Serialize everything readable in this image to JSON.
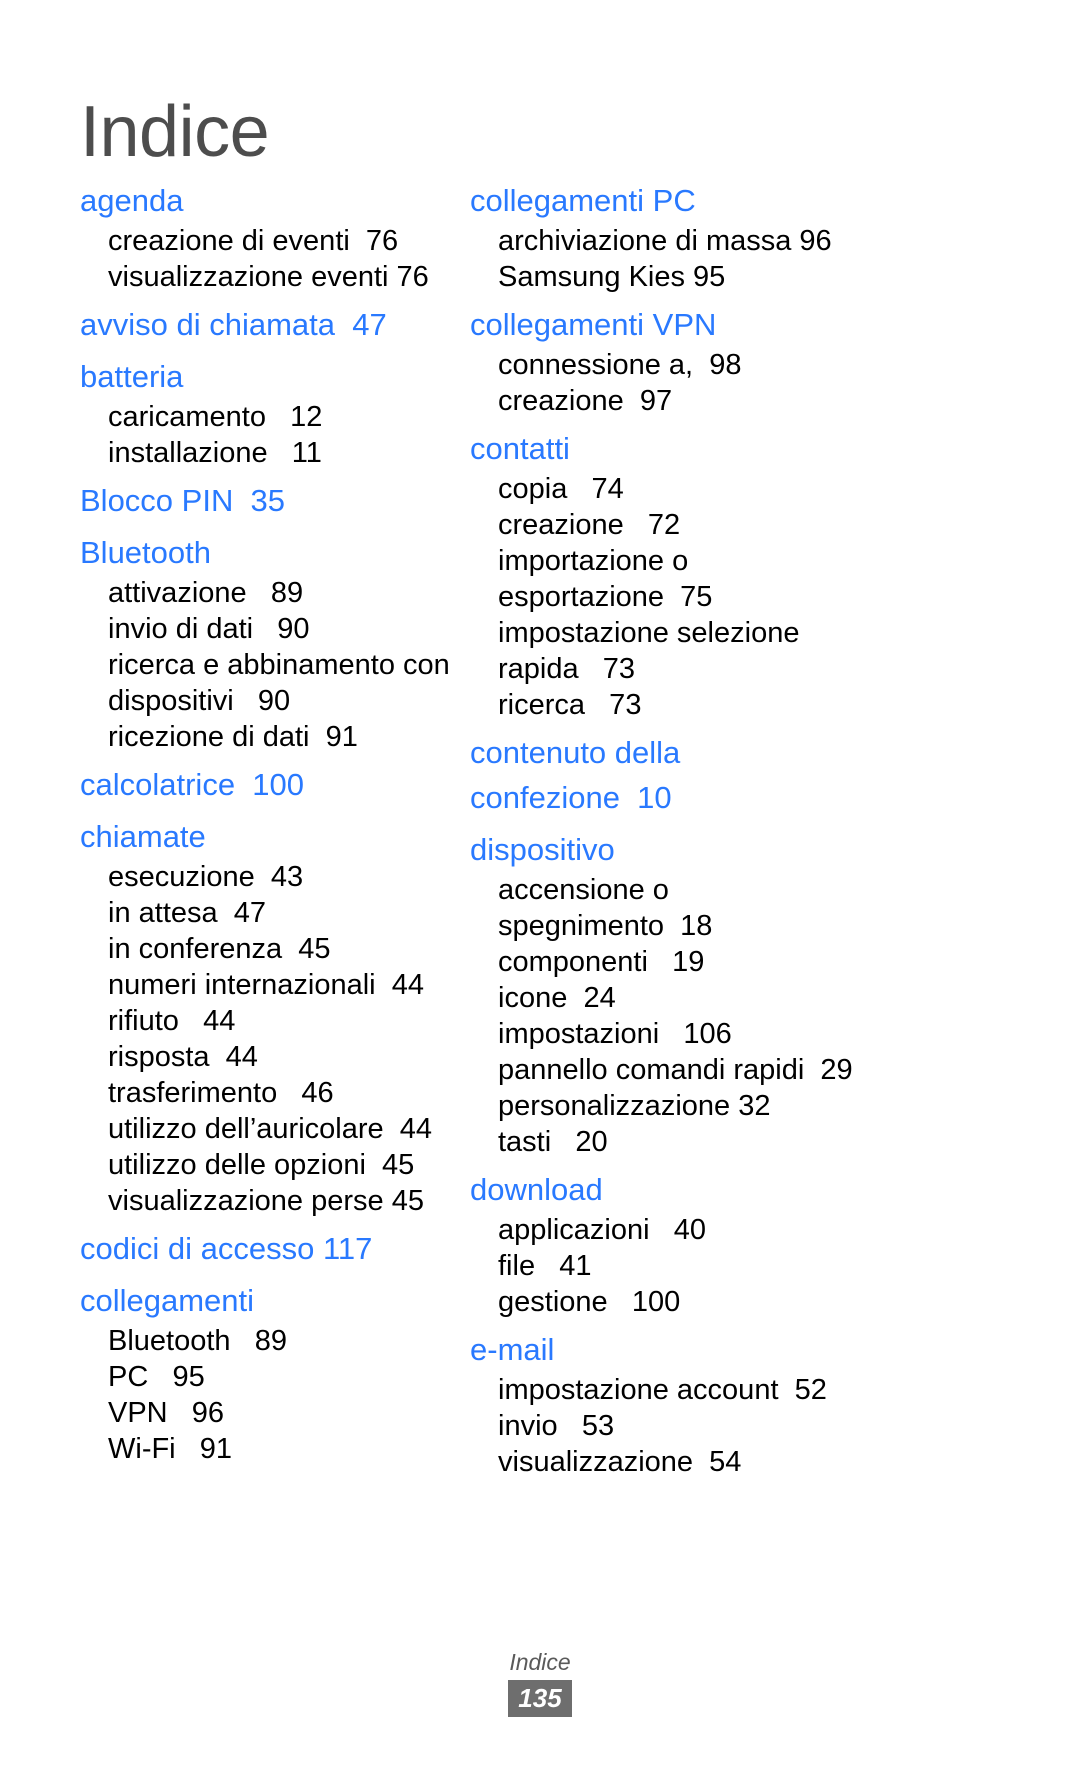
{
  "document": {
    "title": "Indice",
    "accent_color": "#2979ff",
    "title_color": "#4d4d4d",
    "body_color": "#000000"
  },
  "columns": {
    "left": [
      {
        "heading": "agenda",
        "lines": [
          "creazione di eventi  76",
          "visualizzazione eventi 76"
        ]
      },
      {
        "heading": "avviso di chiamata  47",
        "lines": []
      },
      {
        "heading": "batteria",
        "lines": [
          "caricamento   12",
          "installazione   11"
        ]
      },
      {
        "heading": "Blocco PIN  35",
        "lines": []
      },
      {
        "heading": "Bluetooth",
        "lines": [
          "attivazione   89",
          "invio di dati   90",
          "ricerca e abbinamento con",
          "dispositivi   90",
          "ricezione di dati  91"
        ]
      },
      {
        "heading": "calcolatrice  100",
        "lines": []
      },
      {
        "heading": "chiamate",
        "lines": [
          "esecuzione  43",
          "in attesa  47",
          "in conferenza  45",
          "numeri internazionali  44",
          "rifiuto   44",
          "risposta  44",
          "trasferimento   46",
          "utilizzo dell’auricolare  44",
          "utilizzo delle opzioni  45",
          "visualizzazione perse 45"
        ]
      },
      {
        "heading": "codici di accesso 117",
        "lines": []
      },
      {
        "heading": "collegamenti",
        "lines": [
          "Bluetooth   89",
          "PC   95",
          "VPN   96",
          "Wi-Fi   91"
        ]
      }
    ],
    "right": [
      {
        "heading": "collegamenti PC",
        "lines": [
          "archiviazione di massa 96",
          "Samsung Kies 95"
        ]
      },
      {
        "heading": "collegamenti VPN",
        "lines": [
          "connessione a,  98",
          "creazione  97"
        ]
      },
      {
        "heading": "contatti",
        "lines": [
          "copia   74",
          "creazione   72",
          "importazione o",
          "esportazione  75",
          "impostazione selezione",
          "rapida   73",
          "ricerca   73"
        ]
      },
      {
        "heading": "contenuto della\nconfezione  10",
        "lines": []
      },
      {
        "heading": "dispositivo",
        "lines": [
          "accensione o",
          "spegnimento  18",
          "componenti   19",
          "icone  24",
          "impostazioni   106",
          "pannello comandi rapidi  29",
          "personalizzazione 32",
          "tasti   20"
        ]
      },
      {
        "heading": "download",
        "lines": [
          "applicazioni   40",
          "file   41",
          "gestione   100"
        ]
      },
      {
        "heading": "e-mail",
        "lines": [
          "impostazione account  52",
          "invio   53",
          "visualizzazione  54"
        ]
      }
    ]
  },
  "footer": {
    "label": "Indice",
    "page_number": "135"
  }
}
